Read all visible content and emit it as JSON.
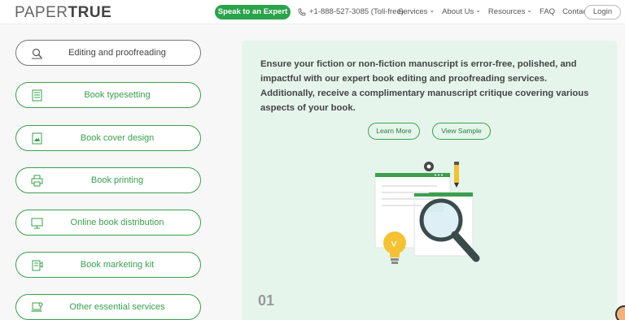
{
  "header": {
    "logo_part1": "PAPER",
    "logo_part2": "TRUE",
    "cta_label": "Speak to an Expert",
    "phone": "+1-888-527-3085 (Toll-free)",
    "nav": [
      "Services",
      "About Us",
      "Resources",
      "FAQ",
      "Contact Us"
    ],
    "login_label": "Login"
  },
  "sidebar": {
    "items": [
      {
        "label": "Editing and proofreading",
        "icon": "magnifier-doc-icon"
      },
      {
        "label": "Book typesetting",
        "icon": "document-lines-icon"
      },
      {
        "label": "Book cover design",
        "icon": "book-cover-icon"
      },
      {
        "label": "Book printing",
        "icon": "printer-icon"
      },
      {
        "label": "Online book distribution",
        "icon": "monitor-icon"
      },
      {
        "label": "Book marketing kit",
        "icon": "marketing-kit-icon"
      },
      {
        "label": "Other essential services",
        "icon": "laptop-gear-icon"
      }
    ]
  },
  "main": {
    "description": "Ensure your fiction or non-fiction manuscript is error-free, polished, and impactful with our expert book editing and proofreading services. Additionally, receive a complimentary manuscript critique covering various aspects of your book.",
    "learn_more": "Learn More",
    "view_sample": "View Sample",
    "step_number": "01"
  },
  "colors": {
    "accent": "#2aa34a",
    "panel_bg": "#e6f5ec"
  }
}
